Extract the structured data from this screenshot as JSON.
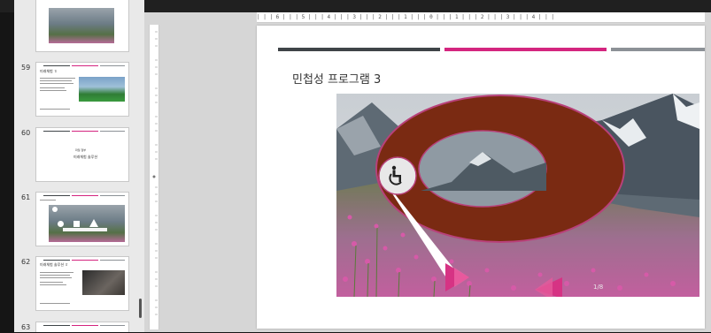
{
  "slides_panel": {
    "slides": [
      {
        "number": "",
        "kind": "photo"
      },
      {
        "number": "59",
        "kind": "text-photo",
        "heading": "미래체험 ㅎ"
      },
      {
        "number": "60",
        "kind": "section",
        "label": "파일 첨부",
        "heading": "미래체험 솔루션"
      },
      {
        "number": "61",
        "kind": "photo-shapes"
      },
      {
        "number": "62",
        "kind": "text-photo",
        "heading": "미래체험 솔루션 ㅎ"
      },
      {
        "number": "63",
        "kind": "partial"
      }
    ]
  },
  "ruler": {
    "horizontal_text": "| | | 6 | | | 5 | | | 4 | | | 3 | | | 2 | | | 1 | | | 0 | | | 1 | | | 2 | | | 3 | | | 4 | | |"
  },
  "slide": {
    "title": "민첩성 프로그램 3",
    "page_indicator": "1/8",
    "accent_bars": [
      "#3f4448",
      "#d4257f",
      "#8c9196"
    ],
    "ring_color": "#7a2a12",
    "ring_stroke": "#b8417a",
    "arrow_color": "#d63384",
    "icon": "wheelchair-icon"
  }
}
